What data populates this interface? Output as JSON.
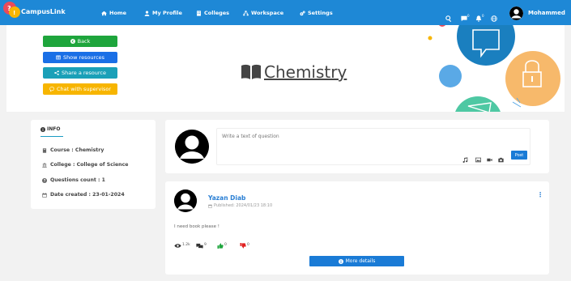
{
  "nav": {
    "brand": "CampusLink",
    "items": [
      {
        "label": "Home",
        "icon": "home-icon"
      },
      {
        "label": "My Profile",
        "icon": "user-icon"
      },
      {
        "label": "Colleges",
        "icon": "building-icon"
      },
      {
        "label": "Workspace",
        "icon": "sitemap-icon"
      },
      {
        "label": "Settings",
        "icon": "gears-icon"
      }
    ],
    "messages_count": "0",
    "notifications_count": "0",
    "user_name": "Mohammed"
  },
  "hero": {
    "buttons": {
      "back": "Back",
      "show_resources": "Show resources",
      "share_resource": "Share a resource",
      "chat_supervisor": "Chat with supervisor"
    },
    "subject_title": "Chemistry"
  },
  "info": {
    "title": "INFO",
    "course": "Course : Chemistry",
    "college": "College : College of Science",
    "questions": "Questions count : 1",
    "date_created": "Date created : 23-01-2024"
  },
  "composer": {
    "placeholder": "Write a text of question",
    "post_label": "Post"
  },
  "post": {
    "author": "Yazan Diab",
    "published": "Published: 2024/01/23 18:10",
    "text": "I need book please !",
    "views": "1.2k",
    "comments": "9",
    "likes": "0",
    "dislikes": "0",
    "more_label": "More details"
  },
  "colors": {
    "primary": "#1e88d6",
    "green": "#1ea53c",
    "teal": "#1aa0b8",
    "yellow": "#f7b500",
    "blue": "#1a6fe6"
  }
}
